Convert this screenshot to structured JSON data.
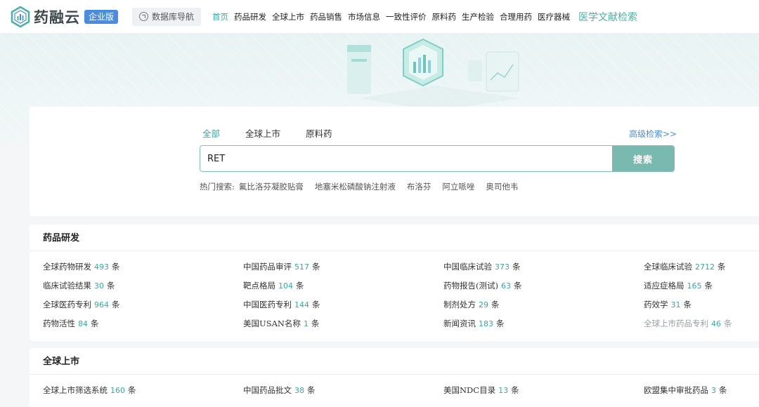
{
  "header": {
    "logo_text": "药融云",
    "edition_badge": "企业版",
    "db_nav_label": "数据库导航",
    "nav": [
      {
        "label": "首页",
        "active": true
      },
      {
        "label": "药品研发",
        "active": false
      },
      {
        "label": "全球上市",
        "active": false
      },
      {
        "label": "药品销售",
        "active": false
      },
      {
        "label": "市场信息",
        "active": false
      },
      {
        "label": "一致性评价",
        "active": false
      },
      {
        "label": "原料药",
        "active": false
      },
      {
        "label": "生产检验",
        "active": false
      },
      {
        "label": "合理用药",
        "active": false
      },
      {
        "label": "医疗器械",
        "active": false
      }
    ],
    "special_link": "医学文献检索"
  },
  "search": {
    "tabs": [
      {
        "label": "全部",
        "active": true
      },
      {
        "label": "全球上市",
        "active": false
      },
      {
        "label": "原料药",
        "active": false
      }
    ],
    "advanced_link": "高级检索>>",
    "query": "RET",
    "button_label": "搜索",
    "hot_label": "热门搜索:",
    "hot_terms": [
      "氟比洛芬凝胶贴膏",
      "地塞米松磷酸钠注射液",
      "布洛芬",
      "阿立哌唑",
      "奥司他韦"
    ]
  },
  "sections": [
    {
      "title": "药品研发",
      "unit": "条",
      "items": [
        {
          "label": "全球药物研发",
          "count": "493"
        },
        {
          "label": "中国药品审评",
          "count": "517"
        },
        {
          "label": "中国临床试验",
          "count": "373"
        },
        {
          "label": "全球临床试验",
          "count": "2712"
        },
        {
          "label": "临床试验结果",
          "count": "30"
        },
        {
          "label": "靶点格局",
          "count": "104"
        },
        {
          "label": "药物报告(测试)",
          "count": "63"
        },
        {
          "label": "适应症格局",
          "count": "165"
        },
        {
          "label": "全球医药专利",
          "count": "964"
        },
        {
          "label": "中国医药专利",
          "count": "144"
        },
        {
          "label": "制剂处方",
          "count": "29"
        },
        {
          "label": "药效学",
          "count": "31"
        },
        {
          "label": "药物活性",
          "count": "84"
        },
        {
          "label": "美国USAN名称",
          "count": "1"
        },
        {
          "label": "新闻资讯",
          "count": "183"
        },
        {
          "label": "全球上市药品专利",
          "count": "46",
          "muted": true
        }
      ]
    },
    {
      "title": "全球上市",
      "unit": "条",
      "items": [
        {
          "label": "全球上市筛选系统",
          "count": "160"
        },
        {
          "label": "中国药品批文",
          "count": "38"
        },
        {
          "label": "美国NDC目录",
          "count": "13"
        },
        {
          "label": "欧盟集中审批药品",
          "count": "3"
        }
      ]
    }
  ],
  "colors": {
    "accent": "#3aa99f",
    "button": "#79b9b0",
    "link_blue": "#4a8de0",
    "badge_blue": "#4a8de0"
  }
}
